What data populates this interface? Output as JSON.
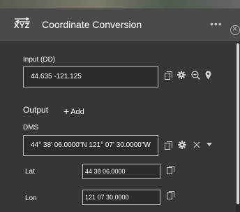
{
  "header": {
    "logo_text": "XYZ",
    "title": "Coordinate Conversion",
    "more_glyph": "•••"
  },
  "input": {
    "label": "Input (DD)",
    "value": "44.635 -121.125"
  },
  "output": {
    "label": "Output",
    "add_label": "Add",
    "add_glyph": "+"
  },
  "dms": {
    "label": "DMS",
    "value": "44° 38' 06.0000\"N 121° 07' 30.0000\"W"
  },
  "lat": {
    "label": "Lat",
    "value": "44 38 06.0000"
  },
  "lon": {
    "label": "Lon",
    "value": "121 07 30.0000"
  },
  "icons": {
    "copy": "copy-icon",
    "settings": "gear-icon",
    "zoom": "zoom-to-icon",
    "map_point": "map-pin-icon",
    "remove": "close-icon",
    "expand": "caret-down-icon"
  },
  "colors": {
    "panel_bg": "#363636",
    "header_bg": "#4a4a4a",
    "input_border": "#bdbdbd",
    "text": "#ffffff",
    "icon": "#cfcfcf"
  }
}
